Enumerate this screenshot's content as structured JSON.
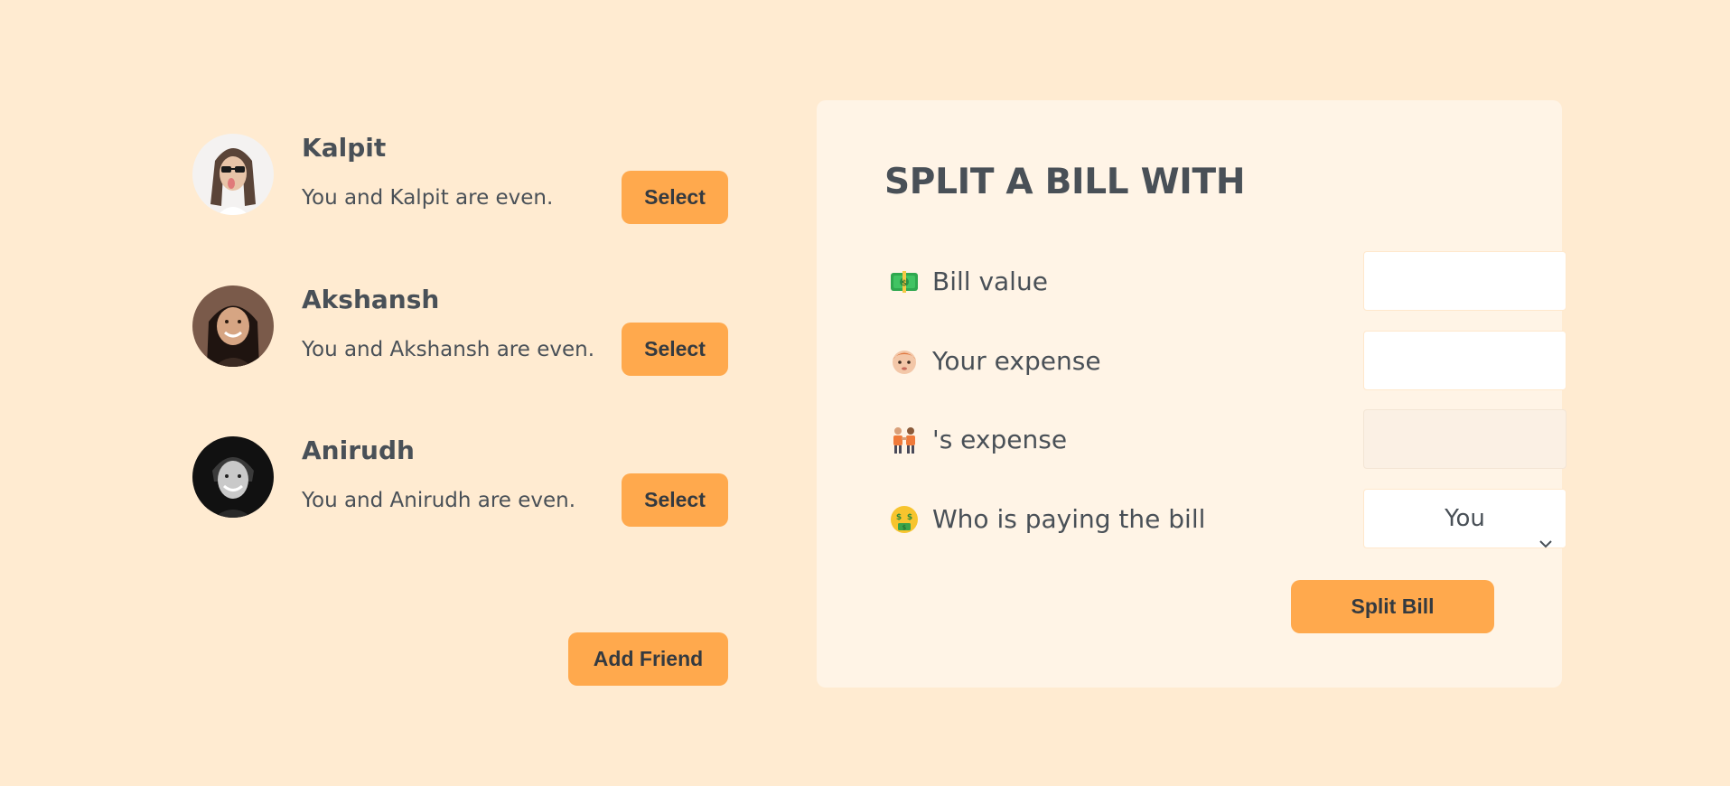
{
  "friends": [
    {
      "name": "Kalpit",
      "status": "You and Kalpit are even.",
      "select_label": "Select"
    },
    {
      "name": "Akshansh",
      "status": "You and Akshansh are even.",
      "select_label": "Select"
    },
    {
      "name": "Anirudh",
      "status": "You and Anirudh are even.",
      "select_label": "Select"
    }
  ],
  "add_friend_label": "Add Friend",
  "split": {
    "title": "SPLIT A BILL WITH",
    "bill_value": {
      "emoji": "money-banknote-icon",
      "label": "Bill value",
      "value": ""
    },
    "your_expense": {
      "emoji": "person-face-icon",
      "label": "Your expense",
      "value": ""
    },
    "friend_expense": {
      "emoji": "two-people-icon",
      "label": "'s expense",
      "value": ""
    },
    "payer": {
      "emoji": "money-mouth-face-icon",
      "label": "Who is paying the bill",
      "selected": "You"
    },
    "submit_label": "Split Bill"
  },
  "colors": {
    "background": "#ffebd1",
    "card": "#fff4e6",
    "accent": "#ffa94d",
    "text": "#495057"
  }
}
